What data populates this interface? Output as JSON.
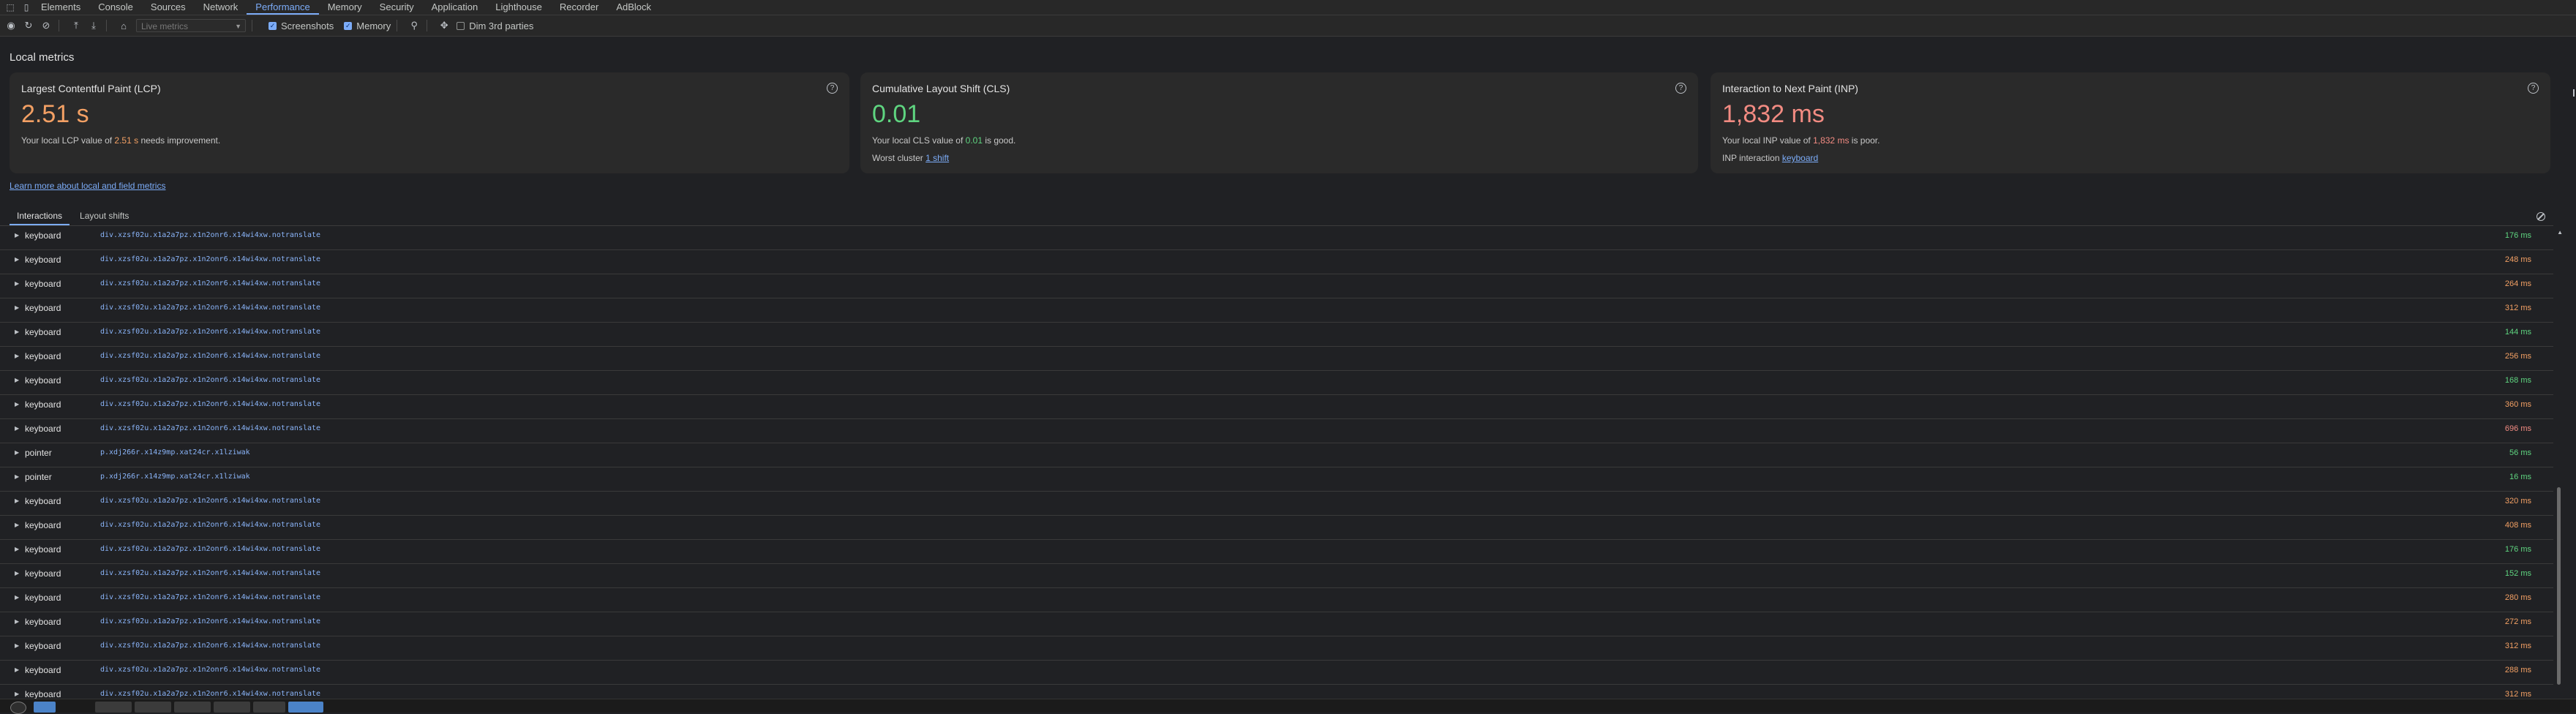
{
  "tabs": [
    "Elements",
    "Console",
    "Sources",
    "Network",
    "Performance",
    "Memory",
    "Security",
    "Application",
    "Lighthouse",
    "Recorder",
    "AdBlock"
  ],
  "active_tab": "Performance",
  "toolbar": {
    "select_placeholder": "Live metrics",
    "screenshots_label": "Screenshots",
    "memory_label": "Memory",
    "dim_label": "Dim 3rd parties"
  },
  "section_title": "Local metrics",
  "cards": {
    "lcp": {
      "title": "Largest Contentful Paint (LCP)",
      "value": "2.51 s",
      "desc_pre": "Your local LCP value of ",
      "desc_value": "2.51 s",
      "desc_post": " needs improvement."
    },
    "cls": {
      "title": "Cumulative Layout Shift (CLS)",
      "value": "0.01",
      "desc_pre": "Your local CLS value of ",
      "desc_value": "0.01",
      "desc_post": " is good.",
      "extra_label": "Worst cluster ",
      "extra_link": "1 shift"
    },
    "inp": {
      "title": "Interaction to Next Paint (INP)",
      "value": "1,832 ms",
      "desc_pre": "Your local INP value of ",
      "desc_value": "1,832 ms",
      "desc_post": " is poor.",
      "extra_label": "INP interaction ",
      "extra_link": "keyboard"
    }
  },
  "learn_more": "Learn more about local and field metrics",
  "subtabs": [
    "Interactions",
    "Layout shifts"
  ],
  "colors": {
    "good": "#5fd580",
    "needs_improvement": "#f3a064",
    "poor": "#f28b82",
    "accent": "#7cacf8"
  },
  "interactions": [
    {
      "type": "keyboard",
      "node": "div.xzsf02u.x1a2a7pz.x1n2onr6.x14wi4xw.notranslate",
      "duration": "176 ms",
      "status": "good"
    },
    {
      "type": "keyboard",
      "node": "div.xzsf02u.x1a2a7pz.x1n2onr6.x14wi4xw.notranslate",
      "duration": "248 ms",
      "status": "needs_improvement"
    },
    {
      "type": "keyboard",
      "node": "div.xzsf02u.x1a2a7pz.x1n2onr6.x14wi4xw.notranslate",
      "duration": "264 ms",
      "status": "needs_improvement"
    },
    {
      "type": "keyboard",
      "node": "div.xzsf02u.x1a2a7pz.x1n2onr6.x14wi4xw.notranslate",
      "duration": "312 ms",
      "status": "needs_improvement"
    },
    {
      "type": "keyboard",
      "node": "div.xzsf02u.x1a2a7pz.x1n2onr6.x14wi4xw.notranslate",
      "duration": "144 ms",
      "status": "good"
    },
    {
      "type": "keyboard",
      "node": "div.xzsf02u.x1a2a7pz.x1n2onr6.x14wi4xw.notranslate",
      "duration": "256 ms",
      "status": "needs_improvement"
    },
    {
      "type": "keyboard",
      "node": "div.xzsf02u.x1a2a7pz.x1n2onr6.x14wi4xw.notranslate",
      "duration": "168 ms",
      "status": "good"
    },
    {
      "type": "keyboard",
      "node": "div.xzsf02u.x1a2a7pz.x1n2onr6.x14wi4xw.notranslate",
      "duration": "360 ms",
      "status": "needs_improvement"
    },
    {
      "type": "keyboard",
      "node": "div.xzsf02u.x1a2a7pz.x1n2onr6.x14wi4xw.notranslate",
      "duration": "696 ms",
      "status": "poor"
    },
    {
      "type": "pointer",
      "node": "p.xdj266r.x14z9mp.xat24cr.x1lziwak",
      "duration": "56 ms",
      "status": "good"
    },
    {
      "type": "pointer",
      "node": "p.xdj266r.x14z9mp.xat24cr.x1lziwak",
      "duration": "16 ms",
      "status": "good"
    },
    {
      "type": "keyboard",
      "node": "div.xzsf02u.x1a2a7pz.x1n2onr6.x14wi4xw.notranslate",
      "duration": "320 ms",
      "status": "needs_improvement"
    },
    {
      "type": "keyboard",
      "node": "div.xzsf02u.x1a2a7pz.x1n2onr6.x14wi4xw.notranslate",
      "duration": "408 ms",
      "status": "needs_improvement"
    },
    {
      "type": "keyboard",
      "node": "div.xzsf02u.x1a2a7pz.x1n2onr6.x14wi4xw.notranslate",
      "duration": "176 ms",
      "status": "good"
    },
    {
      "type": "keyboard",
      "node": "div.xzsf02u.x1a2a7pz.x1n2onr6.x14wi4xw.notranslate",
      "duration": "152 ms",
      "status": "good"
    },
    {
      "type": "keyboard",
      "node": "div.xzsf02u.x1a2a7pz.x1n2onr6.x14wi4xw.notranslate",
      "duration": "280 ms",
      "status": "needs_improvement"
    },
    {
      "type": "keyboard",
      "node": "div.xzsf02u.x1a2a7pz.x1n2onr6.x14wi4xw.notranslate",
      "duration": "272 ms",
      "status": "needs_improvement"
    },
    {
      "type": "keyboard",
      "node": "div.xzsf02u.x1a2a7pz.x1n2onr6.x14wi4xw.notranslate",
      "duration": "312 ms",
      "status": "needs_improvement"
    },
    {
      "type": "keyboard",
      "node": "div.xzsf02u.x1a2a7pz.x1n2onr6.x14wi4xw.notranslate",
      "duration": "288 ms",
      "status": "needs_improvement"
    },
    {
      "type": "keyboard",
      "node": "div.xzsf02u.x1a2a7pz.x1n2onr6.x14wi4xw.notranslate",
      "duration": "312 ms",
      "status": "needs_improvement"
    }
  ]
}
